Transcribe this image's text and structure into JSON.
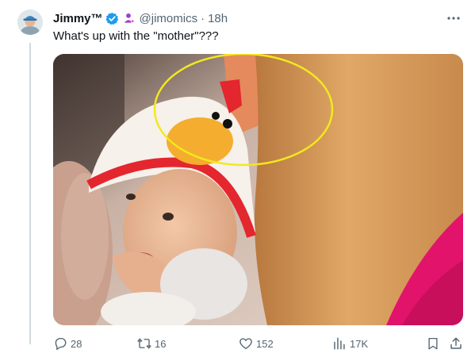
{
  "tweet": {
    "author_display_name": "Jimmy™",
    "author_handle": "@jimomics",
    "separator": "·",
    "timestamp": "18h",
    "text": "What's up with the \"mother\"???",
    "verified": true,
    "media": {
      "highlight_color": "#f2e81f",
      "dominant_colors": {
        "hat_red": "#e4262f",
        "hat_yellow": "#f4ad2e",
        "shirt_pink": "#e2136b",
        "hair": "#d79a5a"
      }
    }
  },
  "actions": {
    "reply_count": "28",
    "repost_count": "16",
    "like_count": "152",
    "view_count": "17K"
  },
  "icons": {
    "more": "more-horizontal-icon",
    "verified": "verified-badge-icon",
    "affiliate": "affiliate-badge-icon",
    "reply": "reply-icon",
    "repost": "repost-icon",
    "like": "like-icon",
    "views": "views-icon",
    "bookmark": "bookmark-icon",
    "share": "share-icon"
  }
}
